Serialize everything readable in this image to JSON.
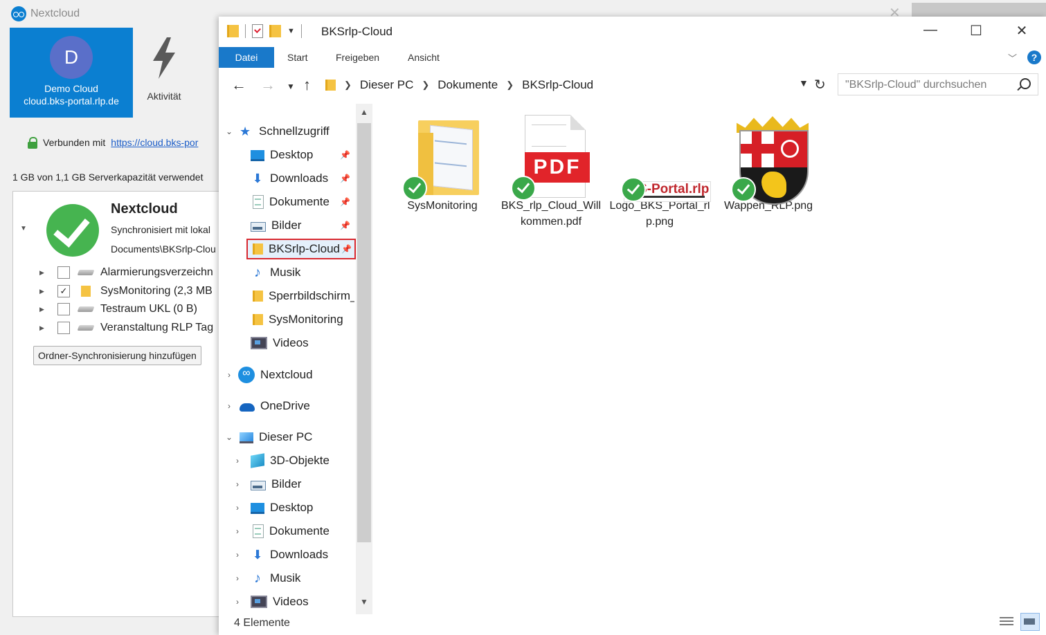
{
  "nextcloud": {
    "app_title": "Nextcloud",
    "account": {
      "avatar_letter": "D",
      "name": "Demo Cloud",
      "host": "cloud.bks-portal.rlp.de"
    },
    "activity_label": "Aktivität",
    "connected_prefix": "Verbunden mit",
    "connected_link": "https://cloud.bks-por",
    "quota_text": "1 GB von 1,1 GB Serverkapazität verwendet",
    "folder": {
      "title": "Nextcloud",
      "sync_text": "Synchronisiert mit lokal",
      "path_text": "Documents\\BKSrlp-Clou"
    },
    "subfolders": [
      {
        "label": "Alarmierungsverzeichn",
        "checked": false,
        "icon": "drive-icon"
      },
      {
        "label": "SysMonitoring (2,3 MB",
        "checked": true,
        "icon": "folder-icon"
      },
      {
        "label": "Testraum UKL (0 B)",
        "checked": false,
        "icon": "drive-icon"
      },
      {
        "label": "Veranstaltung RLP Tag",
        "checked": false,
        "icon": "drive-icon"
      }
    ],
    "add_sync_button": "Ordner-Synchronisierung hinzufügen",
    "accent_color": "#0b7fd1",
    "status_color": "#46b450"
  },
  "explorer": {
    "title": "BKSrlp-Cloud",
    "window_controls": {
      "minimize": "—",
      "maximize": "☐",
      "close": "✕"
    },
    "menu_tabs": [
      "Datei",
      "Start",
      "Freigeben",
      "Ansicht"
    ],
    "breadcrumb": [
      "Dieser PC",
      "Dokumente",
      "BKSrlp-Cloud"
    ],
    "search_placeholder": "\"BKSrlp-Cloud\" durchsuchen",
    "nav": {
      "quick_access": "Schnellzugriff",
      "quick_items": [
        {
          "label": "Desktop",
          "icon": "desktop-icon",
          "pinned": true
        },
        {
          "label": "Downloads",
          "icon": "downloads-icon",
          "pinned": true
        },
        {
          "label": "Dokumente",
          "icon": "documents-icon",
          "pinned": true
        },
        {
          "label": "Bilder",
          "icon": "pictures-icon",
          "pinned": true
        },
        {
          "label": "BKSrlp-Cloud",
          "icon": "folder-icon",
          "pinned": true,
          "selected": true
        },
        {
          "label": "Musik",
          "icon": "music-icon",
          "pinned": false
        },
        {
          "label": "Sperrbildschirm_",
          "icon": "folder-icon",
          "pinned": false
        },
        {
          "label": "SysMonitoring",
          "icon": "folder-icon",
          "pinned": false
        },
        {
          "label": "Videos",
          "icon": "videos-icon",
          "pinned": false
        }
      ],
      "nextcloud": "Nextcloud",
      "onedrive": "OneDrive",
      "this_pc": "Dieser PC",
      "pc_items": [
        {
          "label": "3D-Objekte",
          "icon": "3d-objects-icon"
        },
        {
          "label": "Bilder",
          "icon": "pictures-icon"
        },
        {
          "label": "Desktop",
          "icon": "desktop-icon"
        },
        {
          "label": "Dokumente",
          "icon": "documents-icon"
        },
        {
          "label": "Downloads",
          "icon": "downloads-icon"
        },
        {
          "label": "Musik",
          "icon": "music-icon"
        },
        {
          "label": "Videos",
          "icon": "videos-icon"
        }
      ]
    },
    "files": [
      {
        "name": "SysMonitoring",
        "type": "folder",
        "synced": true
      },
      {
        "name": "BKS_rlp_Cloud_Willkommen.pdf",
        "type": "pdf",
        "synced": true
      },
      {
        "name": "Logo_BKS_Portal_rlp.png",
        "type": "logo",
        "synced": true
      },
      {
        "name": "Wappen_RLP.png",
        "type": "wappen",
        "synced": true
      }
    ],
    "pdf_badge": "PDF",
    "logo_text": "S-Portal.rlp",
    "status_text": "4 Elemente",
    "accent_color": "#1979ca",
    "selection_highlight_color": "#d9282f"
  }
}
